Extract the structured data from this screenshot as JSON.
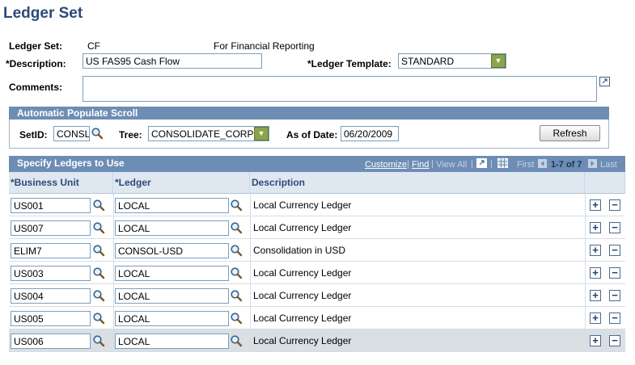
{
  "page": {
    "title": "Ledger Set"
  },
  "header": {
    "ledger_set_label": "Ledger Set:",
    "ledger_set_value": "CF",
    "ledger_set_desc": "For Financial Reporting",
    "description_label": "*Description:",
    "description_value": "US FAS95 Cash Flow",
    "ledger_template_label": "*Ledger Template:",
    "ledger_template_value": "STANDARD",
    "comments_label": "Comments:",
    "comments_value": ""
  },
  "auto_populate": {
    "title": "Automatic Populate Scroll",
    "setid_label": "SetID:",
    "setid_value": "CONSL",
    "tree_label": "Tree:",
    "tree_value": "CONSOLIDATE_CORP",
    "as_of_date_label": "As of Date:",
    "as_of_date_value": "06/20/2009",
    "refresh_label": "Refresh"
  },
  "grid": {
    "title": "Specify Ledgers to Use",
    "customize": "Customize",
    "find": "Find",
    "view_all": "View All",
    "first": "First",
    "range": "1-7 of 7",
    "last": "Last",
    "columns": [
      "*Business Unit",
      "*Ledger",
      "Description"
    ],
    "rows": [
      {
        "bu": "US001",
        "ledger": "LOCAL",
        "desc": "Local Currency Ledger"
      },
      {
        "bu": "US007",
        "ledger": "LOCAL",
        "desc": "Local Currency Ledger"
      },
      {
        "bu": "ELIM7",
        "ledger": "CONSOL-USD",
        "desc": "Consolidation in USD"
      },
      {
        "bu": "US003",
        "ledger": "LOCAL",
        "desc": "Local Currency Ledger"
      },
      {
        "bu": "US004",
        "ledger": "LOCAL",
        "desc": "Local Currency Ledger"
      },
      {
        "bu": "US005",
        "ledger": "LOCAL",
        "desc": "Local Currency Ledger"
      },
      {
        "bu": "US006",
        "ledger": "LOCAL",
        "desc": "Local Currency Ledger"
      }
    ]
  },
  "icons": {
    "lookup": "lookup-magnifier-icon",
    "dropdown": "dropdown-arrow-icon",
    "expand": "expand-icon",
    "add_row": "plus-icon",
    "delete_row": "minus-icon",
    "first_arrow": "left-arrow-icon",
    "last_arrow": "right-arrow-icon"
  },
  "colors": {
    "title": "#2c4a78",
    "header_bar": "#6d8db5",
    "column_header_bg": "#dfe8f1",
    "dropdown_button": "#8aa44a",
    "selected_row": "#dadfe3"
  }
}
